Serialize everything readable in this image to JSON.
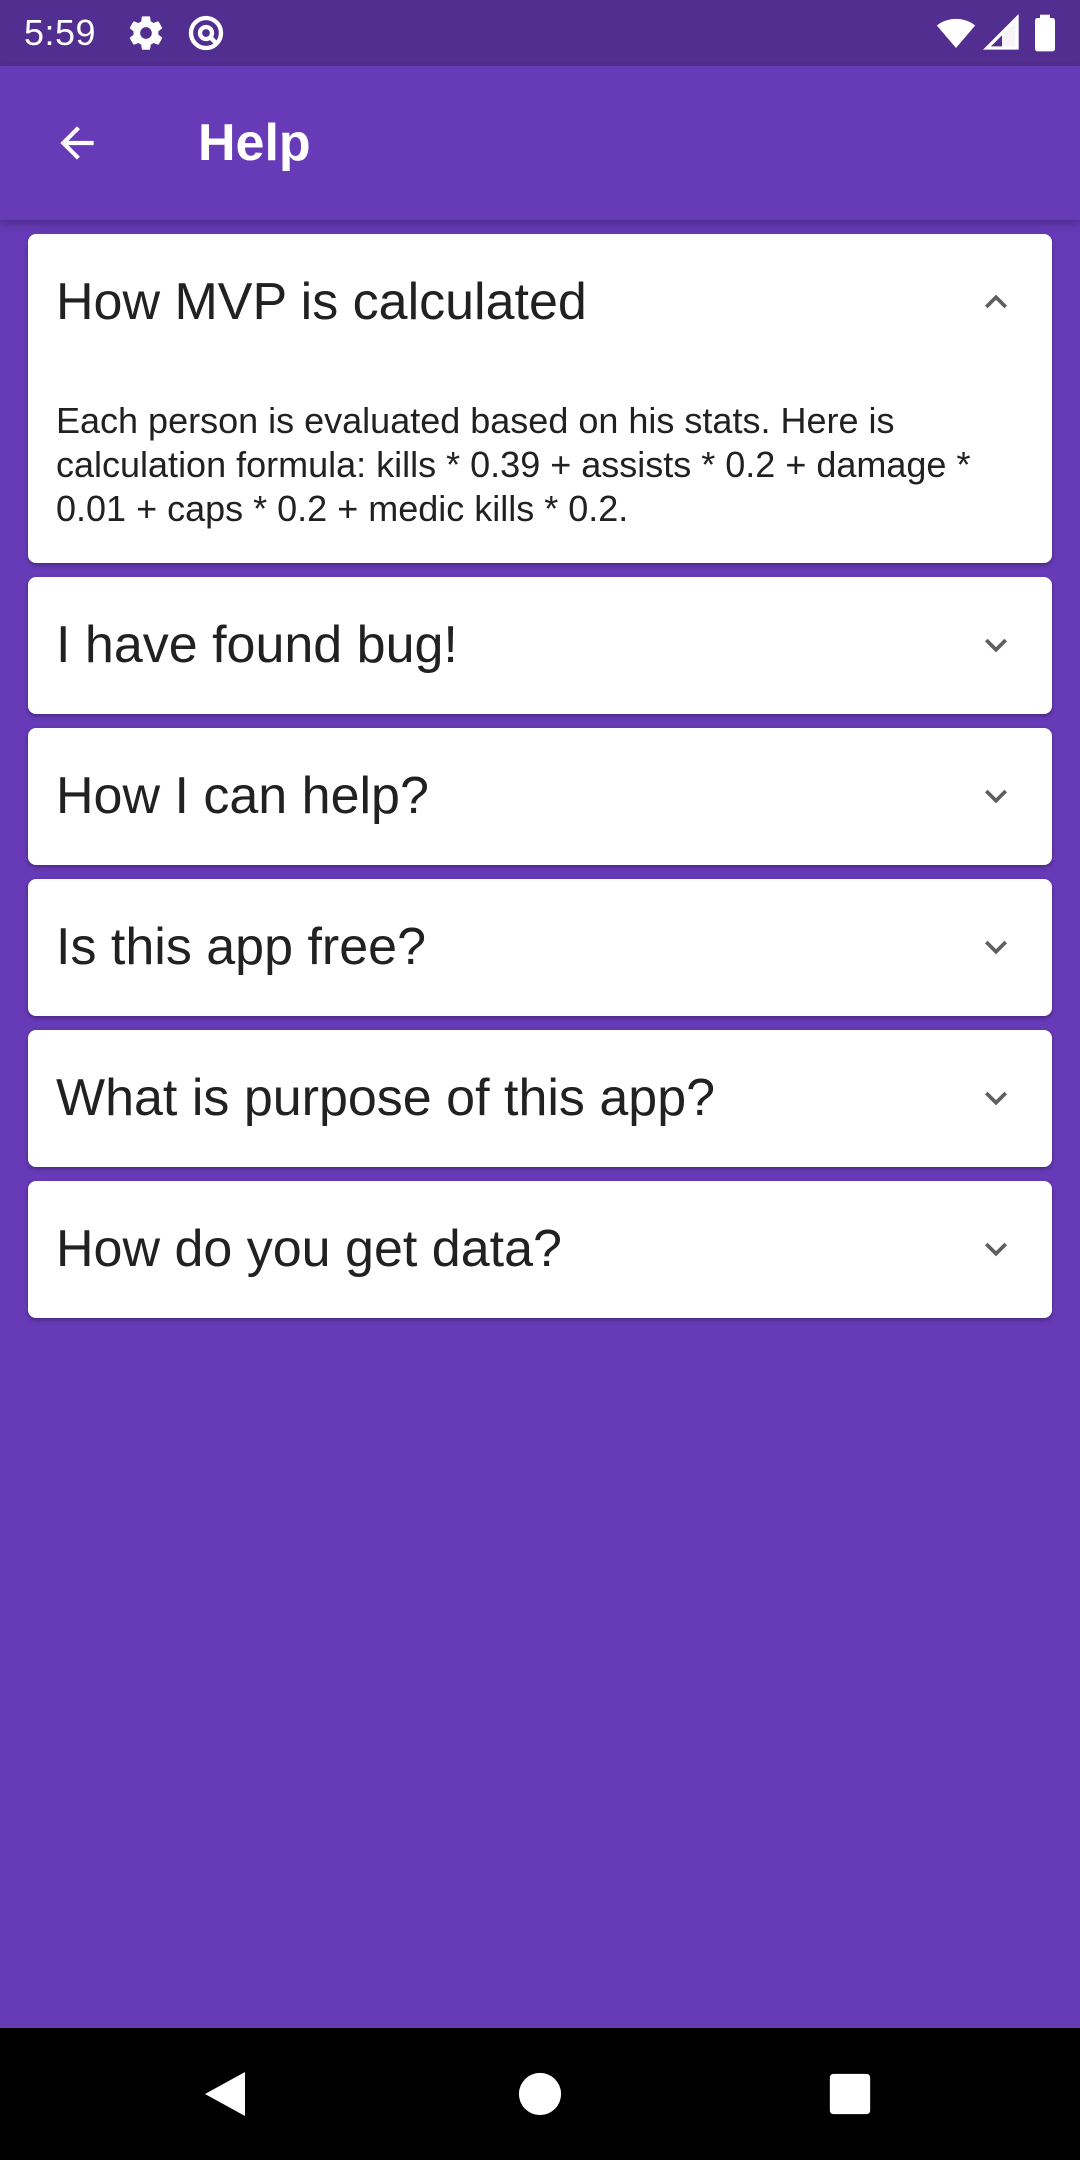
{
  "status_bar": {
    "time": "5:59",
    "icons": [
      "gear-icon",
      "at-sign-icon",
      "wifi-icon",
      "signal-icon",
      "battery-icon"
    ]
  },
  "app_bar": {
    "title": "Help",
    "back_icon": "arrow-left-icon"
  },
  "faq": [
    {
      "question": "How MVP is calculated",
      "expanded": true,
      "answer": "Each person is evaluated based on his stats. Here is calculation formula: kills * 0.39 + assists * 0.2 + damage * 0.01 + caps * 0.2 + medic kills * 0.2."
    },
    {
      "question": "I have found bug!",
      "expanded": false
    },
    {
      "question": "How I can help?",
      "expanded": false
    },
    {
      "question": "Is this app free?",
      "expanded": false
    },
    {
      "question": "What is purpose of this app?",
      "expanded": false
    },
    {
      "question": "How do you get data?",
      "expanded": false
    }
  ],
  "navigation_bar": {
    "buttons": [
      "back-triangle-icon",
      "home-circle-icon",
      "recents-square-icon"
    ]
  },
  "colors": {
    "primary": "#673ab7",
    "status_bar": "#512e8f",
    "card": "#ffffff",
    "text": "#212121",
    "chevron": "#5f5f5f"
  }
}
